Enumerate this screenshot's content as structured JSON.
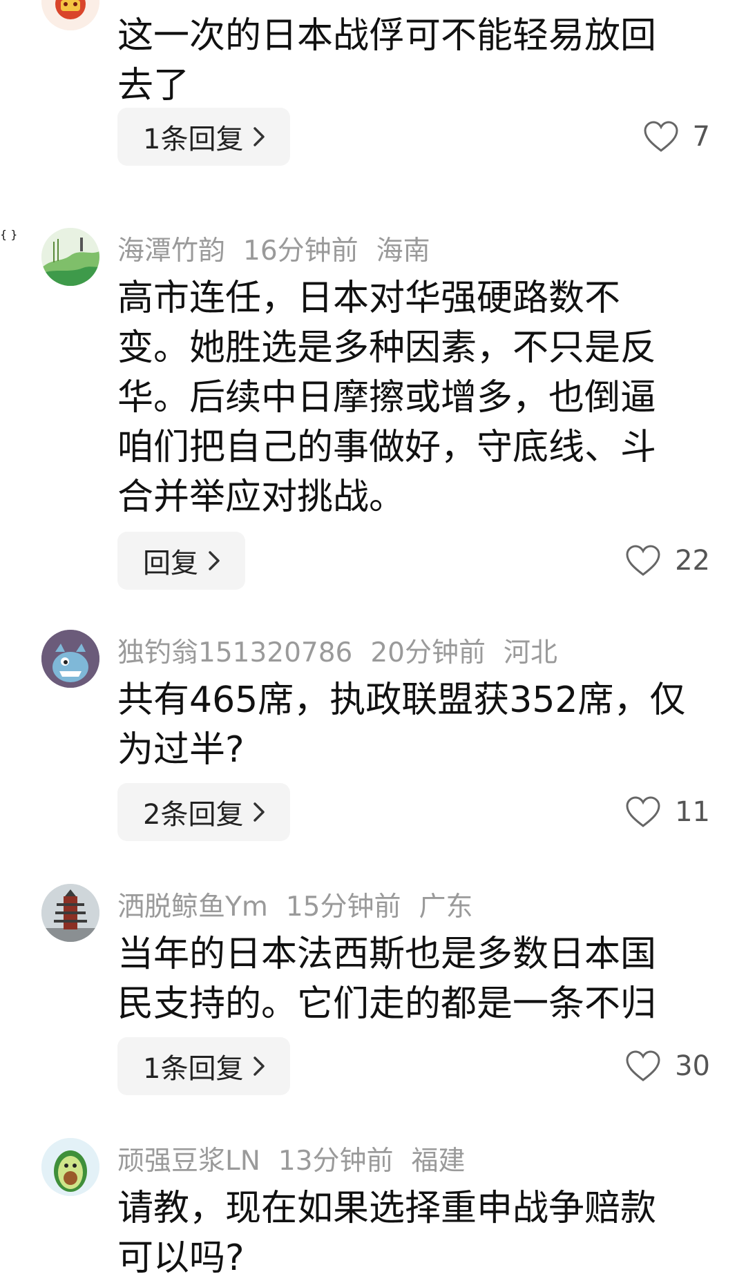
{
  "comments": [
    {
      "username": "",
      "time": "",
      "location": "",
      "avatar_icon": "red-crest-avatar-icon",
      "text": "这一次的日本战俘可不能轻易放回去了",
      "reply_label": "1条回复",
      "likes": "7"
    },
    {
      "username": "海潭竹韵",
      "time": "16分钟前",
      "location": "海南",
      "avatar_icon": "landscape-painting-avatar-icon",
      "text": "高市连任，日本对华强硬路数不变。她胜选是多种因素，不只是反华。后续中日摩擦或增多，也倒逼咱们把自己的事做好，守底线、斗合并举应对挑战。",
      "reply_label": "回复",
      "likes": "22"
    },
    {
      "username": "独钓翁151320786",
      "time": "20分钟前",
      "location": "河北",
      "avatar_icon": "blue-monster-avatar-icon",
      "text": "共有465席，执政联盟获352席，仅为过半?",
      "reply_label": "2条回复",
      "likes": "11"
    },
    {
      "username": "洒脱鲸鱼Ym",
      "time": "15分钟前",
      "location": "广东",
      "avatar_icon": "pagoda-avatar-icon",
      "text": "当年的日本法西斯也是多数日本国民支持的。它们走的都是一条不归",
      "reply_label": "1条回复",
      "likes": "30"
    },
    {
      "username": "顽强豆浆LN",
      "time": "13分钟前",
      "location": "福建",
      "avatar_icon": "avocado-avatar-icon",
      "text": "请教，现在如果选择重申战争赔款可以吗?",
      "reply_label": "",
      "likes": ""
    }
  ],
  "colors": {
    "meta": "#9a9a9a",
    "text": "#111111",
    "reply_bg": "#f4f4f4",
    "like_icon": "#666666"
  }
}
